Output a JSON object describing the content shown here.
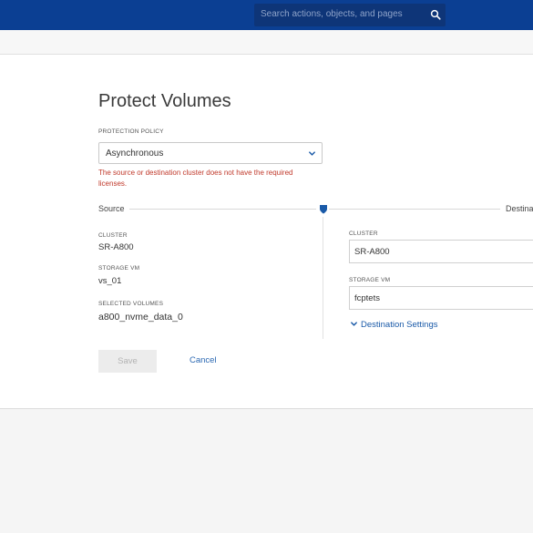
{
  "header": {
    "search_placeholder": "Search actions, objects, and pages",
    "search_icon": "search-icon"
  },
  "dialog": {
    "title": "Protect Volumes",
    "protection_policy_label": "PROTECTION POLICY",
    "protection_policy_value": "Asynchronous",
    "error_message": "The source or destination cluster does not have the required licenses.",
    "source_label": "Source",
    "destination_label": "Destina",
    "source": {
      "cluster_label": "CLUSTER",
      "cluster_value": "SR-A800",
      "storage_vm_label": "STORAGE VM",
      "storage_vm_value": "vs_01",
      "selected_volumes_label": "SELECTED VOLUMES",
      "selected_volumes_value": "a800_nvme_data_0"
    },
    "destination": {
      "cluster_label": "CLUSTER",
      "cluster_value": "SR-A800",
      "storage_vm_label": "STORAGE VM",
      "storage_vm_value": "fcptets",
      "settings_link": "Destination Settings"
    },
    "save_label": "Save",
    "cancel_label": "Cancel"
  },
  "colors": {
    "header_bg": "#0b3f93",
    "error": "#c0392b",
    "link": "#2b68b2",
    "accent": "#1a5aa8"
  }
}
